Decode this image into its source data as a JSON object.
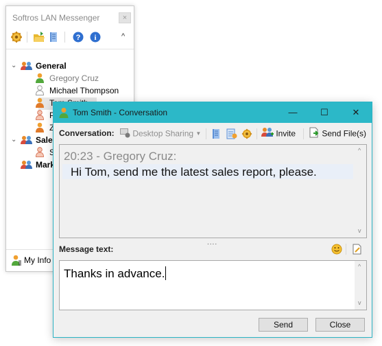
{
  "main_window": {
    "title": "Softros LAN Messenger",
    "close_symbol": "×",
    "toolbar_icons": [
      "gear-icon",
      "open-folder-icon",
      "notes-icon",
      "help-icon",
      "info-icon"
    ],
    "collapse_symbol": "^"
  },
  "tree": {
    "groups": [
      {
        "label": "General",
        "expanded": true,
        "users": [
          {
            "name": "Gregory Cruz",
            "status": "online"
          },
          {
            "name": "Michael Thompson",
            "status": "offline"
          },
          {
            "name": "Tom Smith",
            "status": "online",
            "selected": true
          },
          {
            "name": "P",
            "status": "away"
          },
          {
            "name": "Z",
            "status": "online"
          }
        ]
      },
      {
        "label": "Sales",
        "expanded": true,
        "users": [
          {
            "name": "S",
            "status": "away"
          }
        ]
      },
      {
        "label": "Mark",
        "expanded": false,
        "users": []
      }
    ],
    "expander_open": "⌄",
    "expander_closed": "›"
  },
  "status_bar": {
    "my_info": "My Info"
  },
  "conversation": {
    "title": "Tom Smith - Conversation",
    "window_buttons": {
      "minimize": "—",
      "maximize": "☐",
      "close": "✕"
    },
    "toolbar": {
      "label": "Conversation:",
      "desktop_sharing": "Desktop Sharing",
      "invite": "Invite",
      "send_files": "Send File(s)"
    },
    "history": {
      "header": "20:23 - Gregory Cruz:",
      "message": "Hi Tom, send me the latest sales report,  please."
    },
    "message_label": "Message text:",
    "grip": "....",
    "input_value": "Thanks in advance.",
    "buttons": {
      "send": "Send",
      "close": "Close"
    },
    "scroll_up": "^",
    "scroll_down": "v"
  },
  "colors": {
    "title_bar": "#2cb8c8",
    "history_highlight": "#e9eff8",
    "selection": "#e6e6e6"
  }
}
